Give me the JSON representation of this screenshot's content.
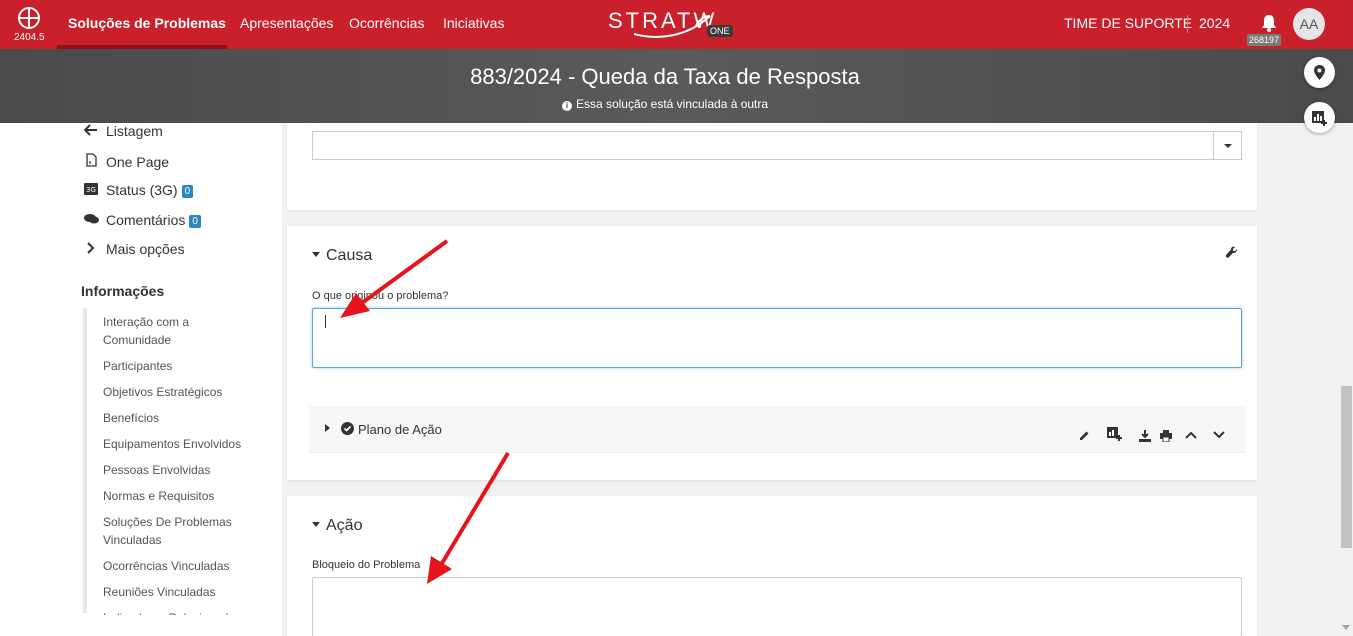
{
  "header": {
    "version": "2404.5",
    "nav": [
      "Soluções de Problemas",
      "Apresentações",
      "Ocorrências",
      "Iniciativas"
    ],
    "brand": "STRATW",
    "brand_tag": "ONE",
    "team": "TIME DE SUPORTE",
    "year": "2024",
    "notifications": "268197",
    "avatar": "AA",
    "accent": "#c9202b"
  },
  "title": {
    "text": "883/2024 - Queda da Taxa de Resposta",
    "notice": "Essa solução está vinculada à outra"
  },
  "sidebar": {
    "links": [
      {
        "label": "Listagem",
        "icon": "arrow-left-icon"
      },
      {
        "label": "One Page",
        "icon": "document-icon"
      },
      {
        "label": "Status (3G)",
        "icon": "3g-icon",
        "badge": "0"
      },
      {
        "label": "Comentários",
        "icon": "comments-icon",
        "badge": "0"
      },
      {
        "label": "Mais opções",
        "icon": "chevron-right-icon"
      }
    ],
    "info_heading": "Informações",
    "info_items": [
      "Interação com a Comunidade",
      "Participantes",
      "Objetivos Estratégicos",
      "Benefícios",
      "Equipamentos Envolvidos",
      "Pessoas Envolvidas",
      "Normas e Requisitos",
      "Soluções De Problemas Vinculadas",
      "Ocorrências Vinculadas",
      "Reuniões Vinculadas",
      "Indicadores Relacionados"
    ]
  },
  "causa": {
    "title": "Causa",
    "field_label": "O que originou o problema?",
    "value": "",
    "subpanel": "Plano de Ação"
  },
  "acao": {
    "title": "Ação",
    "field_label": "Bloqueio do Problema",
    "value": ""
  }
}
